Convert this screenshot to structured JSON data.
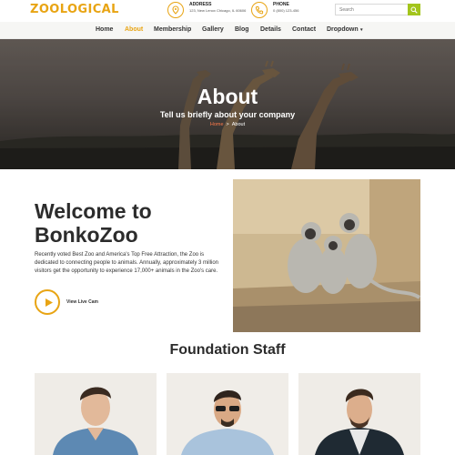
{
  "brand": {
    "logo_text": "ZOOLOGICAL",
    "accent": "#e8a413",
    "search_btn_color": "#a3c51c"
  },
  "header": {
    "address_label": "ADDRESS",
    "address_value": "123, New Lenox Chicago, IL 60606",
    "phone_label": "PHONE",
    "phone_value": "0 (800) 123-456",
    "search_placeholder": "Search"
  },
  "nav": {
    "items": [
      {
        "label": "Home"
      },
      {
        "label": "About"
      },
      {
        "label": "Membership"
      },
      {
        "label": "Gallery"
      },
      {
        "label": "Blog"
      },
      {
        "label": "Details"
      },
      {
        "label": "Contact"
      },
      {
        "label": "Dropdown"
      }
    ],
    "active": "About"
  },
  "hero": {
    "title": "About",
    "subtitle": "Tell us briefly about your company",
    "breadcrumb": {
      "home": "Home",
      "separator": ">",
      "current": "About"
    }
  },
  "welcome": {
    "title": "Welcome to BonkoZoo",
    "text": "Recently voted Best Zoo and America's Top Free Attraction, the Zoo is dedicated to connecting people to animals. Annually, approximately 3 million visitors get the opportunity to experience 17,000+ animals in the Zoo's care.",
    "live_cam_label": "View Live Cam"
  },
  "staff": {
    "title": "Foundation Staff"
  }
}
